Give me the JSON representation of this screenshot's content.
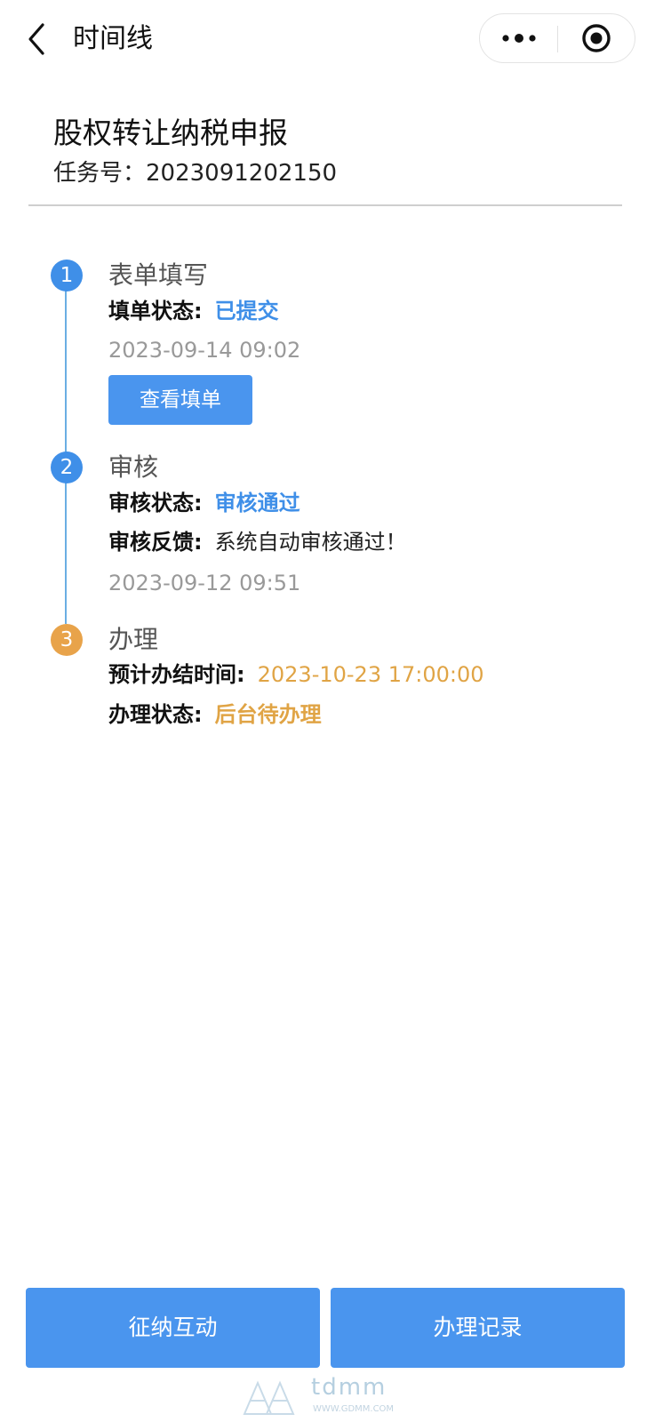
{
  "nav": {
    "title": "时间线",
    "back_icon": "chevron-left-icon",
    "more_icon": "more-dots-icon",
    "target_icon": "target-icon"
  },
  "header": {
    "title": "股权转让纳税申报",
    "task_no": "任务号：2023091202150"
  },
  "timeline": {
    "steps": [
      {
        "index": "1",
        "title": "表单填写",
        "status_label": "填单状态:",
        "status_value": "已提交",
        "time": "2023-09-14 09:02",
        "button_label": "查看填单"
      },
      {
        "index": "2",
        "title": "审核",
        "status_label": "审核状态:",
        "status_value": "审核通过",
        "feedback_label": "审核反馈:",
        "feedback_value": "系统自动审核通过！",
        "time": "2023-09-12 09:51"
      },
      {
        "index": "3",
        "title": "办理",
        "eta_label": "预计办结时间:",
        "eta_value": "2023-10-23 17:00:00",
        "status_label": "办理状态:",
        "status_value": "后台待办理"
      }
    ]
  },
  "bottom": {
    "left_label": "征纳互动",
    "right_label": "办理记录"
  },
  "watermark": {
    "text": "tdmm",
    "url": "WWW.GDMM.COM"
  },
  "colors": {
    "accent_blue": "#3f8fe8",
    "accent_orange": "#e0a445",
    "button_blue": "#4a95ee"
  }
}
